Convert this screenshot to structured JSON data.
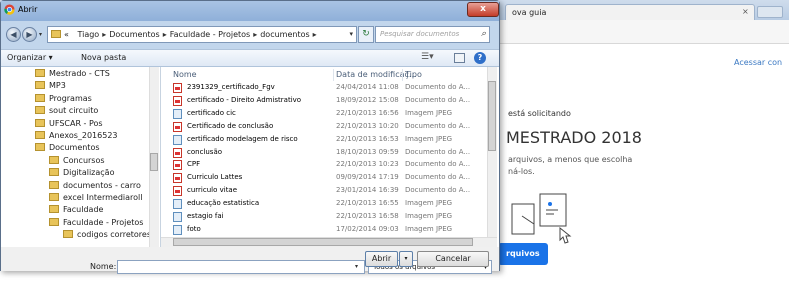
{
  "browser": {
    "tab_label": "ova guia",
    "tab_close": "×",
    "acessar": "Acessar con",
    "solicitando": "está solicitando",
    "heading": "MESTRADO 2018",
    "line1": "arquivos, a menos que escolha",
    "line2": "ná-los.",
    "button_label": "rquivos"
  },
  "dialog": {
    "title": "Abrir",
    "close_label": "x",
    "breadcrumb": [
      "«",
      "Tiago",
      "Documentos",
      "Faculdade - Projetos",
      "documentos"
    ],
    "search_placeholder": "Pesquisar documentos",
    "toolbar": {
      "organizar": "Organizar ▾",
      "nova_pasta": "Nova pasta"
    },
    "tree": [
      {
        "label": "Mestrado - CTS",
        "indent": 1
      },
      {
        "label": "MP3",
        "indent": 1
      },
      {
        "label": "Programas",
        "indent": 1
      },
      {
        "label": "sout circuito",
        "indent": 1
      },
      {
        "label": "UFSCAR - Pos",
        "indent": 1
      },
      {
        "label": "Anexos_2016523",
        "indent": 1
      },
      {
        "label": "Documentos",
        "indent": 1
      },
      {
        "label": "Concursos",
        "indent": 2
      },
      {
        "label": "Digitalização",
        "indent": 2
      },
      {
        "label": "documentos - carro",
        "indent": 2
      },
      {
        "label": "excel Intermediaroll",
        "indent": 2
      },
      {
        "label": "Faculdade",
        "indent": 2
      },
      {
        "label": "Faculdade - Projetos",
        "indent": 2
      },
      {
        "label": "codigos corretores",
        "indent": 3
      }
    ],
    "columns": {
      "name": "Nome",
      "date": "Data de modificaç...",
      "type": "Tipo"
    },
    "files": [
      {
        "name": "2391329_certificado_Fgv",
        "date": "24/04/2014 11:08",
        "type": "Documento do A...",
        "icon": "pdf"
      },
      {
        "name": "certificado - Direito Admistrativo",
        "date": "18/09/2012 15:08",
        "type": "Documento do A...",
        "icon": "pdf"
      },
      {
        "name": "certificado cic",
        "date": "22/10/2013 16:56",
        "type": "Imagem JPEG",
        "icon": "jpg"
      },
      {
        "name": "Certificado de conclusão",
        "date": "22/10/2013 10:20",
        "type": "Documento do A...",
        "icon": "pdf"
      },
      {
        "name": "certificado modelagem de risco",
        "date": "22/10/2013 16:53",
        "type": "Imagem JPEG",
        "icon": "jpg"
      },
      {
        "name": "conclusão",
        "date": "18/10/2013 09:59",
        "type": "Documento do A...",
        "icon": "pdf"
      },
      {
        "name": "CPF",
        "date": "22/10/2013 10:23",
        "type": "Documento do A...",
        "icon": "pdf"
      },
      {
        "name": "Curriculo Lattes",
        "date": "09/09/2014 17:19",
        "type": "Documento do A...",
        "icon": "pdf"
      },
      {
        "name": "curriculo vitae",
        "date": "23/01/2014 16:39",
        "type": "Documento do A...",
        "icon": "pdf"
      },
      {
        "name": "educação estatistica",
        "date": "22/10/2013 16:55",
        "type": "Imagem JPEG",
        "icon": "jpg"
      },
      {
        "name": "estagio fai",
        "date": "22/10/2013 16:58",
        "type": "Imagem JPEG",
        "icon": "jpg"
      },
      {
        "name": "foto",
        "date": "17/02/2014 09:03",
        "type": "Imagem JPEG",
        "icon": "jpg"
      }
    ],
    "name_label": "Nome:",
    "name_value": "",
    "file_type": "Todos os arquivos",
    "open_label": "Abrir",
    "cancel_label": "Cancelar"
  }
}
